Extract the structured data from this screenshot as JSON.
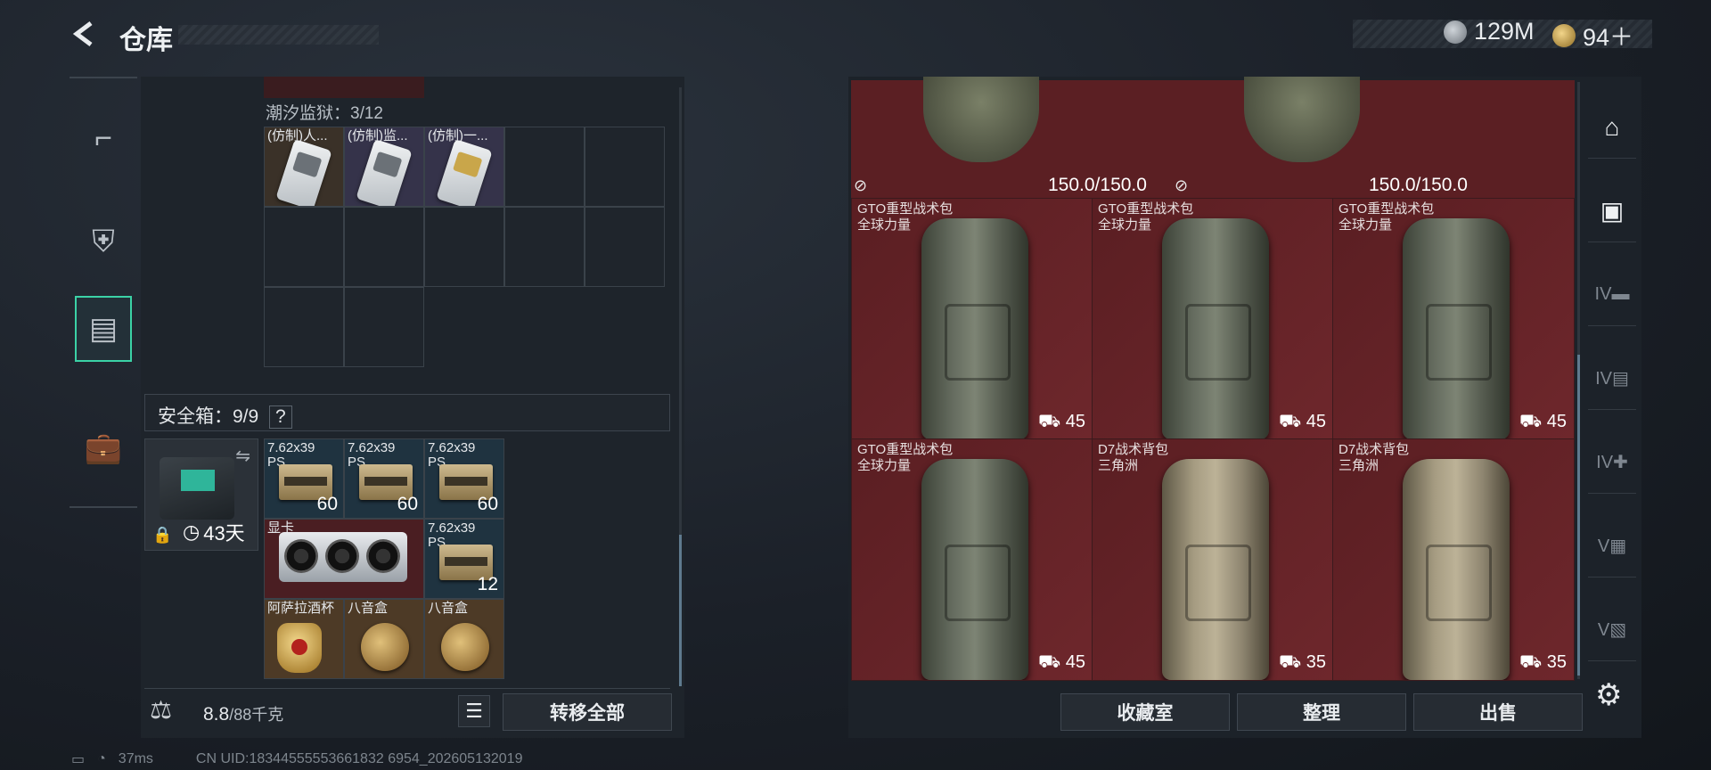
{
  "header": {
    "title": "仓库"
  },
  "currency": {
    "silver": "129M",
    "gold": "94＋"
  },
  "sidenav": [
    {
      "name": "pistol-icon"
    },
    {
      "name": "armor-icon"
    },
    {
      "name": "backpack-icon",
      "active": true
    },
    {
      "name": "briefcase-icon"
    }
  ],
  "container": {
    "label": "潮汐监狱：3/12",
    "items": [
      "(仿制)人...",
      "(仿制)监...",
      "(仿制)一..."
    ]
  },
  "safe": {
    "label": "安全箱：9/9",
    "help": "?",
    "timer": "43天",
    "items": [
      {
        "label": "7.62x39\nPS",
        "qty": "60"
      },
      {
        "label": "7.62x39\nPS",
        "qty": "60"
      },
      {
        "label": "7.62x39\nPS",
        "qty": "60"
      },
      {
        "label": "显卡",
        "qty": ""
      },
      {
        "label": "7.62x39\nPS",
        "qty": "12"
      },
      {
        "label": "阿萨拉酒杯",
        "qty": ""
      },
      {
        "label": "八音盒",
        "qty": ""
      },
      {
        "label": "八音盒",
        "qty": ""
      }
    ]
  },
  "footer_left": {
    "weight": "8.8",
    "capacity": "/88千克",
    "transfer_all": "转移全部"
  },
  "stash": {
    "vest_durability": [
      "150.0/150.0",
      "150.0/150.0"
    ],
    "bags": [
      {
        "name": "GTO重型战术包",
        "brand": "全球力量",
        "value": "45",
        "color": "green"
      },
      {
        "name": "GTO重型战术包",
        "brand": "全球力量",
        "value": "45",
        "color": "green"
      },
      {
        "name": "GTO重型战术包",
        "brand": "全球力量",
        "value": "45",
        "color": "green"
      },
      {
        "name": "GTO重型战术包",
        "brand": "全球力量",
        "value": "45",
        "color": "green"
      },
      {
        "name": "D7战术背包",
        "brand": "三角洲",
        "value": "35",
        "color": "tan"
      },
      {
        "name": "D7战术背包",
        "brand": "三角洲",
        "value": "35",
        "color": "tan"
      }
    ]
  },
  "footer_right": {
    "collection": "收藏室",
    "sort": "整理",
    "sell": "出售"
  },
  "rtabs": [
    {
      "name": "all-tab-icon",
      "text": "⌂"
    },
    {
      "name": "gun-tab-icon",
      "text": "▣"
    },
    {
      "name": "iv-weapon-tab-icon",
      "text": "IV▬"
    },
    {
      "name": "iv-folder-tab-icon",
      "text": "IV▤"
    },
    {
      "name": "iv-med-tab-icon",
      "text": "IV✚"
    },
    {
      "name": "v-ammo-tab-icon",
      "text": "V▦"
    },
    {
      "name": "v-misc-tab-icon",
      "text": "V▧"
    }
  ],
  "status": {
    "ping": "37ms",
    "uid": "CN UID:18344555553661832 6954_202605132019"
  }
}
